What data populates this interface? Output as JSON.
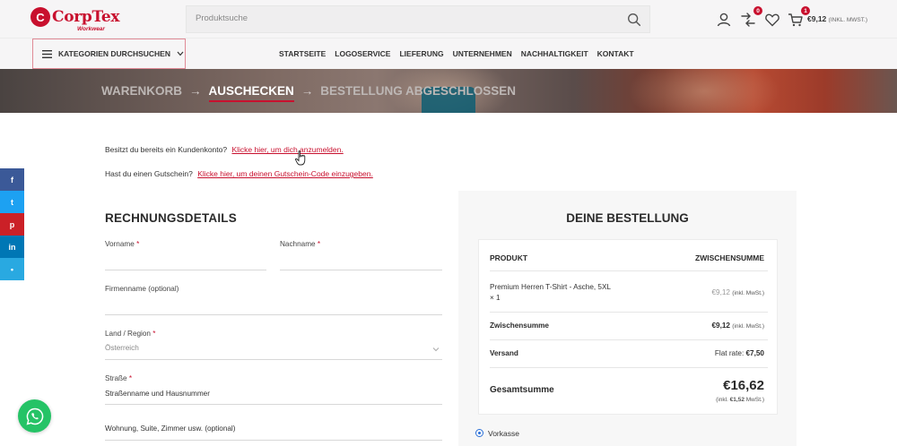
{
  "brand": {
    "logo_text": "CorpTex",
    "logo_sub": "Workwear",
    "accent_color": "#c8102e"
  },
  "search": {
    "placeholder": "Produktsuche"
  },
  "header_icons": {
    "compare_count": "0",
    "cart_count": "1",
    "cart_total": "€9,12",
    "cart_vat_note": "(INKL. MWST.)"
  },
  "categories_button": {
    "label": "KATEGORIEN DURCHSUCHEN"
  },
  "nav": {
    "items": [
      "STARTSEITE",
      "LOGOSERVICE",
      "LIEFERUNG",
      "UNTERNEHMEN",
      "NACHHALTIGKEIT",
      "KONTAKT"
    ]
  },
  "checkout_steps": {
    "step1": "WARENKORB",
    "step2": "AUSCHECKEN",
    "step3": "BESTELLUNG ABGESCHLOSSEN",
    "arrow": "→"
  },
  "notices": {
    "login_text": "Besitzt du bereits ein Kundenkonto?",
    "login_link": "Klicke hier, um dich anzumelden.",
    "coupon_text": "Hast du einen Gutschein?",
    "coupon_link": "Klicke hier, um deinen Gutschein-Code einzugeben."
  },
  "social": {
    "items": [
      {
        "icon": "facebook-icon",
        "glyph": "f",
        "color": "#3b5998"
      },
      {
        "icon": "twitter-icon",
        "glyph": "t",
        "color": "#1da1f2"
      },
      {
        "icon": "pinterest-icon",
        "glyph": "p",
        "color": "#cb2027"
      },
      {
        "icon": "linkedin-icon",
        "glyph": "in",
        "color": "#0077b5"
      },
      {
        "icon": "share-icon",
        "glyph": "•",
        "color": "#29a9e1"
      }
    ]
  },
  "billing": {
    "title": "RECHNUNGSDETAILS",
    "first_name_label": "Vorname",
    "last_name_label": "Nachname",
    "company_label": "Firmenname (optional)",
    "country_label": "Land / Region",
    "country_value": "Österreich",
    "street_label": "Straße",
    "street_placeholder": "Straßenname und Hausnummer",
    "address2_placeholder": "Wohnung, Suite, Zimmer usw. (optional)",
    "required_mark": "*"
  },
  "order": {
    "title": "DEINE BESTELLUNG",
    "col_product": "PRODUKT",
    "col_subtotal": "ZWISCHENSUMME",
    "item_name": "Premium Herren T-Shirt - Asche, 5XL",
    "item_qty": "× 1",
    "item_price": "€9,12",
    "item_price_note": "(inkl. MwSt.)",
    "subtotal_label": "Zwischensumme",
    "subtotal_value": "€9,12",
    "subtotal_note": "(inkl. MwSt.)",
    "shipping_label": "Versand",
    "shipping_text": "Flat rate:",
    "shipping_value": "€7,50",
    "total_label": "Gesamtsumme",
    "total_value": "€16,62",
    "total_tax_prefix": "(inkl.",
    "total_tax_value": "€1,52",
    "total_tax_suffix": "MwSt.)"
  },
  "payment": {
    "method_label": "Vorkasse"
  }
}
